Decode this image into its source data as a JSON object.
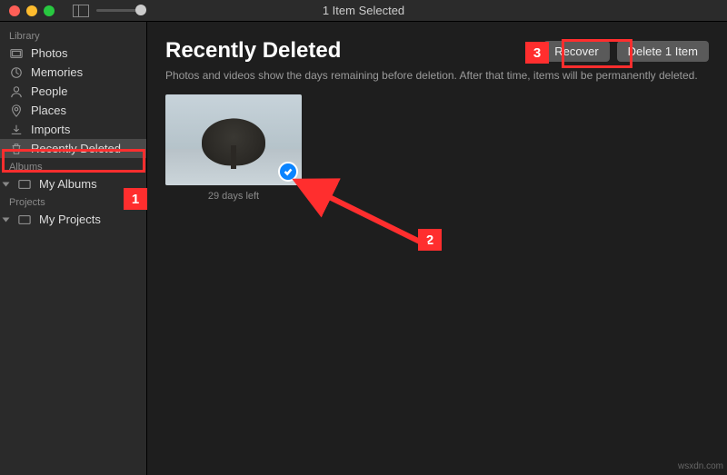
{
  "titlebar": {
    "title": "1 Item Selected"
  },
  "sidebar": {
    "sections": {
      "library": {
        "label": "Library",
        "items": [
          {
            "label": "Photos"
          },
          {
            "label": "Memories"
          },
          {
            "label": "People"
          },
          {
            "label": "Places"
          },
          {
            "label": "Imports"
          },
          {
            "label": "Recently Deleted"
          }
        ]
      },
      "albums": {
        "label": "Albums",
        "items": [
          {
            "label": "My Albums"
          }
        ]
      },
      "projects": {
        "label": "Projects",
        "items": [
          {
            "label": "My Projects"
          }
        ]
      }
    }
  },
  "content": {
    "title": "Recently Deleted",
    "subtitle": "Photos and videos show the days remaining before deletion. After that time, items will be permanently deleted.",
    "buttons": {
      "recover": "Recover",
      "delete": "Delete 1 Item"
    },
    "items": [
      {
        "caption": "29 days left",
        "selected": true
      }
    ]
  },
  "annotations": {
    "step1": "1",
    "step2": "2",
    "step3": "3"
  },
  "watermark": "wsxdn.com"
}
